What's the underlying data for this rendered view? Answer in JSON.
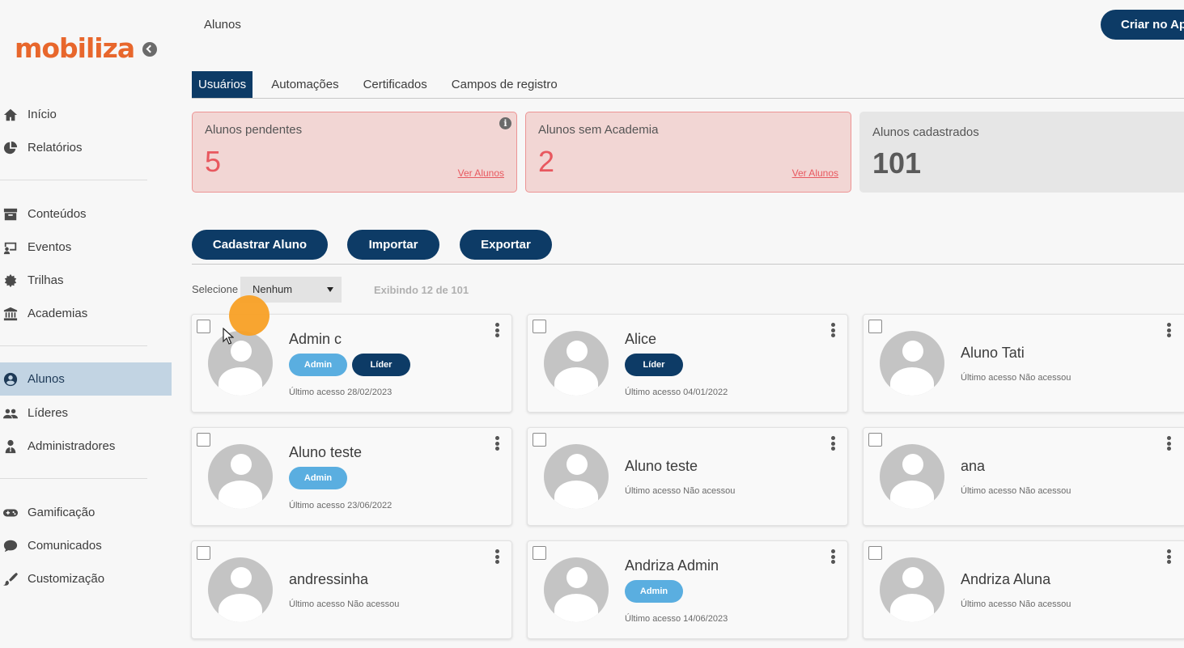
{
  "brand": {
    "logo": "mobiliza"
  },
  "sidebar": {
    "items": [
      {
        "label": "Início",
        "icon": "home-icon"
      },
      {
        "label": "Relatórios",
        "icon": "pie-chart-icon"
      },
      {
        "label": "Conteúdos",
        "icon": "archive-icon"
      },
      {
        "label": "Eventos",
        "icon": "presentation-icon"
      },
      {
        "label": "Trilhas",
        "icon": "badge-icon"
      },
      {
        "label": "Academias",
        "icon": "institution-icon"
      },
      {
        "label": "Alunos",
        "icon": "user-circle-icon",
        "active": true
      },
      {
        "label": "Líderes",
        "icon": "users-icon"
      },
      {
        "label": "Administradores",
        "icon": "user-tie-icon"
      },
      {
        "label": "Gamificação",
        "icon": "gamepad-icon"
      },
      {
        "label": "Comunicados",
        "icon": "speech-bubble-icon"
      },
      {
        "label": "Customização",
        "icon": "brush-icon"
      }
    ]
  },
  "header": {
    "title": "Alunos",
    "create_app_label": "Criar no Ap"
  },
  "tabs": [
    {
      "label": "Usuários",
      "active": true
    },
    {
      "label": "Automações"
    },
    {
      "label": "Certificados"
    },
    {
      "label": "Campos de registro"
    }
  ],
  "stats": [
    {
      "label": "Alunos pendentes",
      "value": "5",
      "link": "Ver Alunos"
    },
    {
      "label": "Alunos sem Academia",
      "value": "2",
      "link": "Ver Alunos"
    },
    {
      "label": "Alunos cadastrados",
      "value": "101"
    }
  ],
  "actions": {
    "register": "Cadastrar Aluno",
    "import": "Importar",
    "export": "Exportar"
  },
  "selection": {
    "label": "Selecione",
    "value": "Nenhum",
    "showing": "Exibindo 12 de 101"
  },
  "users": [
    {
      "name": "Admin c",
      "badges": [
        "Admin",
        "Líder"
      ],
      "access": "Último acesso 28/02/2023"
    },
    {
      "name": "Alice",
      "badges": [
        "Líder"
      ],
      "access": "Último acesso 04/01/2022"
    },
    {
      "name": "Aluno Tati",
      "badges": [],
      "access": "Último acesso Não acessou"
    },
    {
      "name": "Aluno teste",
      "badges": [
        "Admin"
      ],
      "access": "Último acesso 23/06/2022"
    },
    {
      "name": "Aluno teste",
      "badges": [],
      "access": "Último acesso Não acessou"
    },
    {
      "name": "ana",
      "badges": [],
      "access": "Último acesso Não acessou"
    },
    {
      "name": "andressinha",
      "badges": [],
      "access": "Último acesso Não acessou"
    },
    {
      "name": "Andriza Admin",
      "badges": [
        "Admin"
      ],
      "access": "Último acesso 14/06/2023"
    },
    {
      "name": "Andriza Aluna",
      "badges": [],
      "access": "Último acesso Não acessou"
    }
  ],
  "colors": {
    "primary": "#0d3b66",
    "brand": "#e8672c",
    "admin_badge": "#5aaee0",
    "alert": "#e8585f",
    "sidebar_active": "#c2d4e3"
  }
}
